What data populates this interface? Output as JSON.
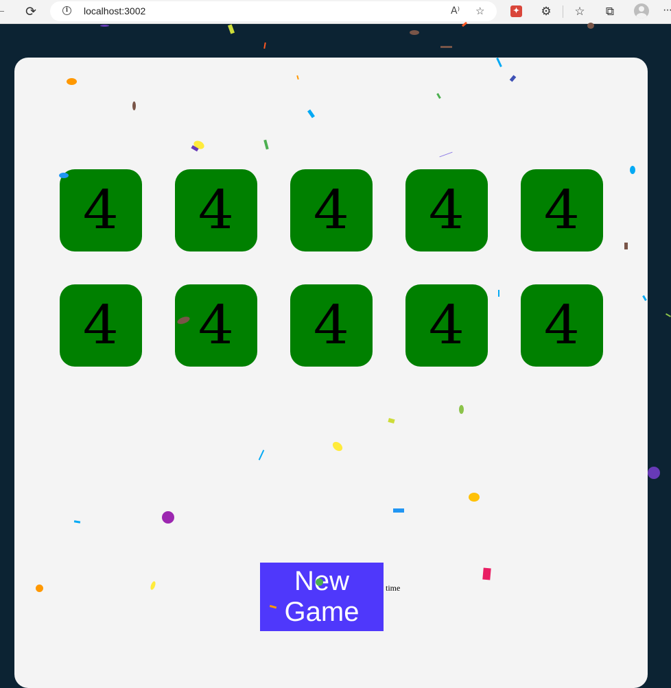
{
  "browser": {
    "url": "localhost:3002",
    "reload_glyph": "⟳",
    "info_glyph": "i",
    "read_aloud_glyph": "A⁾",
    "favorite_glyph": "☆",
    "extension_glyph": "⚙",
    "favorites_bar_glyph": "☆",
    "collections_glyph": "⧉",
    "more_glyph": "···"
  },
  "game": {
    "tiles": [
      "4",
      "4",
      "4",
      "4",
      "4",
      "4",
      "4",
      "4",
      "4",
      "4"
    ],
    "new_game_label": "New Game",
    "time_label": "time"
  },
  "colors": {
    "background": "#0c2333",
    "card": "#f4f4f4",
    "tile": "#008000",
    "button": "#4f38fb"
  }
}
